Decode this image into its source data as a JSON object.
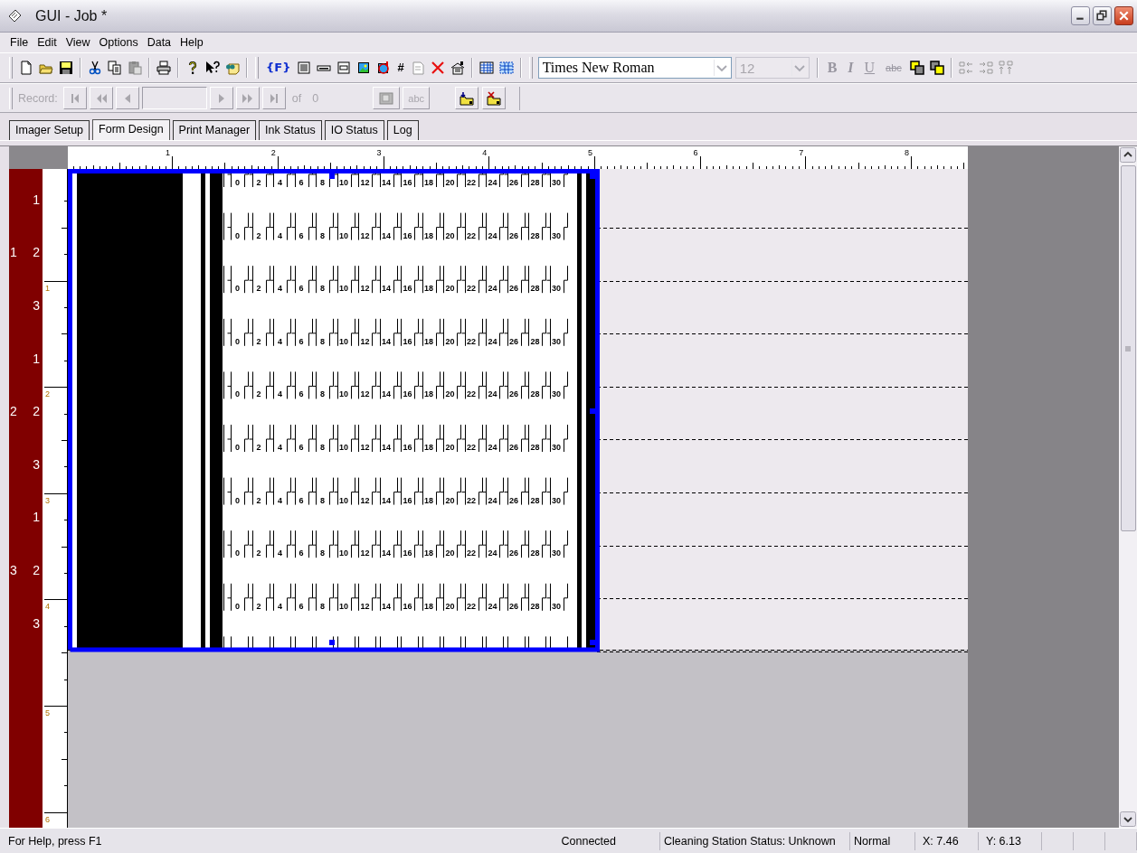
{
  "window": {
    "title": "GUI - Job *"
  },
  "menu": [
    "File",
    "Edit",
    "View",
    "Options",
    "Data",
    "Help"
  ],
  "toolbar": {
    "field_button": "{F}",
    "number_button": "#",
    "font": {
      "value": "Times New Roman",
      "disabled": false
    },
    "size": {
      "value": "12",
      "disabled": true
    },
    "format_buttons": [
      {
        "kind": "bold",
        "label": "B",
        "disabled": true
      },
      {
        "kind": "italic",
        "label": "I",
        "disabled": true
      },
      {
        "kind": "underline",
        "label": "U",
        "disabled": true
      },
      {
        "kind": "strike",
        "label": "abc",
        "disabled": true
      }
    ]
  },
  "record_bar": {
    "label": "Record:",
    "of": "of",
    "count": "0",
    "disabled": true,
    "abc_button": {
      "label": "abc",
      "disabled": true
    }
  },
  "tabs": [
    {
      "label": "Imager Setup",
      "selected": false
    },
    {
      "label": "Form Design",
      "selected": true
    },
    {
      "label": "Print Manager",
      "selected": false
    },
    {
      "label": "Ink Status",
      "selected": false
    },
    {
      "label": "IO Status",
      "selected": false
    },
    {
      "label": "Log",
      "selected": false
    }
  ],
  "top_ruler": [
    "1",
    "2",
    "3",
    "4",
    "5",
    "6",
    "7",
    "8"
  ],
  "left_ruler": [
    "1",
    "2",
    "3",
    "4",
    "5",
    "6"
  ],
  "lanes": [
    {
      "label": "1",
      "rows": [
        "1",
        "2",
        "3"
      ]
    },
    {
      "label": "2",
      "rows": [
        "1",
        "2",
        "3"
      ]
    },
    {
      "label": "3",
      "rows": [
        "1",
        "2",
        "3"
      ]
    }
  ],
  "scale_rows": [
    {
      "labels": [
        "0",
        "2",
        "4",
        "6",
        "8",
        "10",
        "12",
        "14",
        "16",
        "18",
        "20",
        "22",
        "24",
        "26",
        "28",
        "30"
      ]
    },
    {
      "labels": [
        "0",
        "2",
        "4",
        "6",
        "8",
        "10",
        "12",
        "14",
        "16",
        "18",
        "20",
        "22",
        "24",
        "26",
        "28",
        "30"
      ]
    },
    {
      "labels": [
        "0",
        "2",
        "4",
        "6",
        "8",
        "10",
        "12",
        "14",
        "16",
        "18",
        "20",
        "22",
        "24",
        "26",
        "28",
        "30"
      ]
    },
    {
      "labels": [
        "0",
        "2",
        "4",
        "6",
        "8",
        "10",
        "12",
        "14",
        "16",
        "18",
        "20",
        "22",
        "24",
        "26",
        "28",
        "30"
      ]
    },
    {
      "labels": [
        "0",
        "2",
        "4",
        "6",
        "8",
        "10",
        "12",
        "14",
        "16",
        "18",
        "20",
        "22",
        "24",
        "26",
        "28",
        "30"
      ]
    },
    {
      "labels": [
        "0",
        "2",
        "4",
        "6",
        "8",
        "10",
        "12",
        "14",
        "16",
        "18",
        "20",
        "22",
        "24",
        "26",
        "28",
        "30"
      ]
    },
    {
      "labels": [
        "0",
        "2",
        "4",
        "6",
        "8",
        "10",
        "12",
        "14",
        "16",
        "18",
        "20",
        "22",
        "24",
        "26",
        "28",
        "30"
      ]
    },
    {
      "labels": [
        "0",
        "2",
        "4",
        "6",
        "8",
        "10",
        "12",
        "14",
        "16",
        "18",
        "20",
        "22",
        "24",
        "26",
        "28",
        "30"
      ]
    },
    {
      "labels": [
        "0",
        "2",
        "4",
        "6",
        "8",
        "10",
        "12",
        "14",
        "16",
        "18",
        "20",
        "22",
        "24",
        "26",
        "28",
        "30"
      ]
    }
  ],
  "status_bar": {
    "help": "For Help, press F1",
    "panes": [
      "Connected",
      "Cleaning Station Status: Unknown",
      "Normal",
      "X: 7.46",
      "Y: 6.13"
    ]
  }
}
